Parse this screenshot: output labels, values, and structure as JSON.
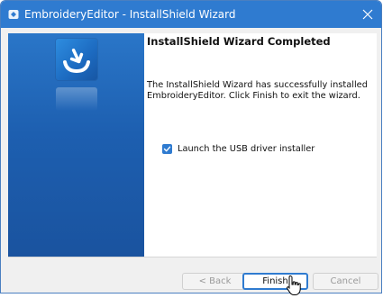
{
  "window": {
    "title": "EmbroideryEditor - InstallShield Wizard"
  },
  "panel": {
    "heading": "InstallShield Wizard Completed",
    "message": "The InstallShield Wizard has successfully installed EmbroideryEditor. Click Finish to exit the wizard.",
    "checkbox": {
      "label": "Launch the USB driver installer",
      "checked": true
    }
  },
  "buttons": {
    "back": "< Back",
    "finish": "Finish",
    "cancel": "Cancel"
  },
  "colors": {
    "accent": "#2f7bd0",
    "sidebar": "#1d5fb0",
    "panel": "#ffffff"
  },
  "icons": [
    "app-icon",
    "close-icon",
    "installshield-logo-icon",
    "checkmark-icon",
    "mouse-cursor-icon"
  ]
}
